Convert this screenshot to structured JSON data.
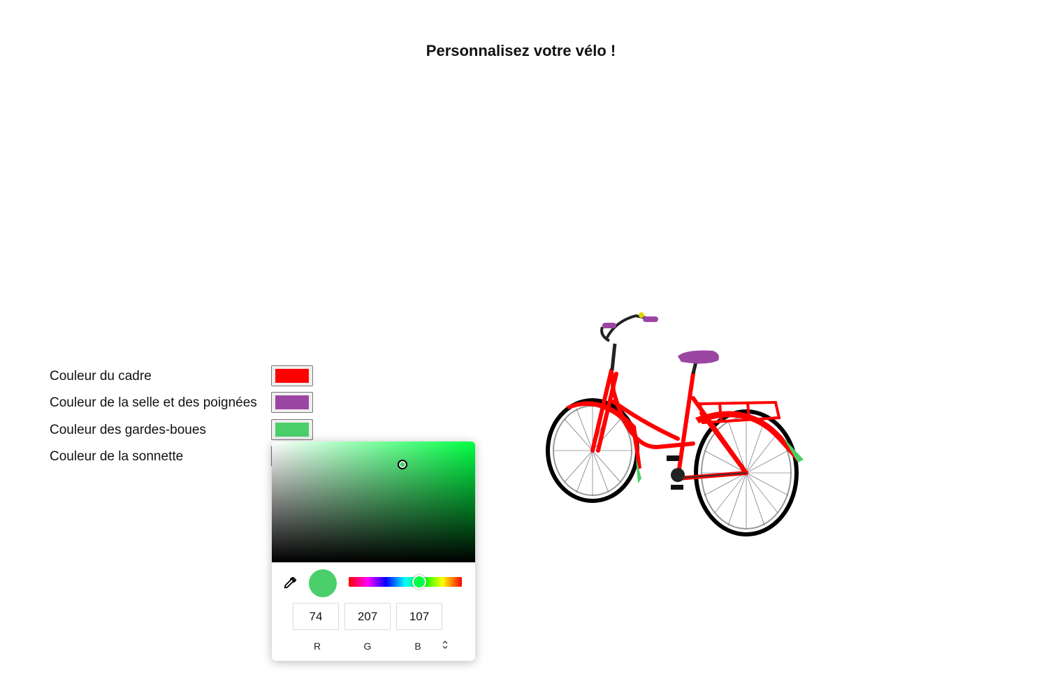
{
  "page": {
    "title": "Personnalisez votre vélo !"
  },
  "options": [
    {
      "label": "Couleur du cadre",
      "color": "#ff0000"
    },
    {
      "label": "Couleur de la selle et des poignées",
      "color": "#9c46a4"
    },
    {
      "label": "Couleur des gardes-boues",
      "color": "#4acf6b"
    },
    {
      "label": "Couleur de la sonnette",
      "color": "#4acf6b"
    }
  ],
  "picker": {
    "current_color": "#4acf6b",
    "hue_color": "#00ff44",
    "r": "74",
    "g": "207",
    "b": "107",
    "labels": {
      "r": "R",
      "g": "G",
      "b": "B"
    },
    "icons": {
      "eyedropper": "eyedropper-icon",
      "mode_toggle": "updown-chevron-icon"
    }
  },
  "bike": {
    "frame_color": "#ff0000",
    "saddle_color": "#9c46a4",
    "mudguard_color": "#4acf6b",
    "bell_color": "#d8d800"
  }
}
